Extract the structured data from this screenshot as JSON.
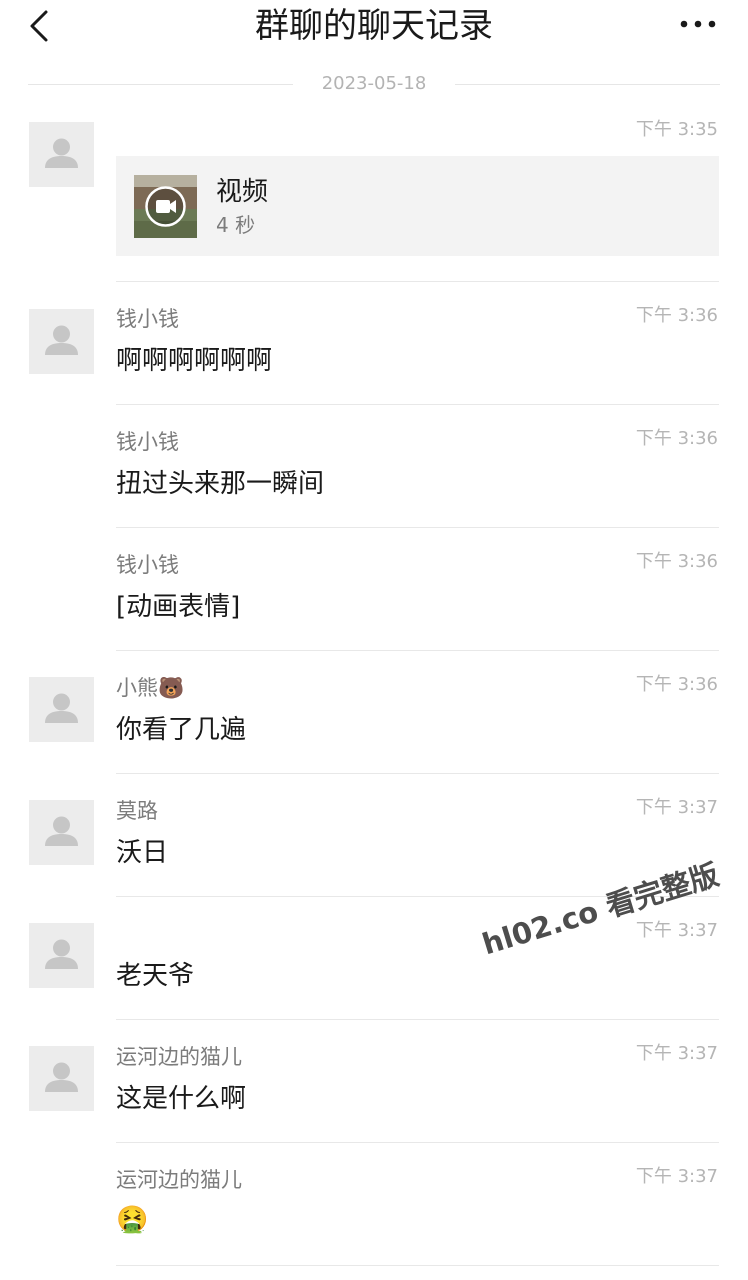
{
  "header": {
    "title": "群聊的聊天记录"
  },
  "date_separator": "2023-05-18",
  "video": {
    "title": "视频",
    "duration": "4 秒"
  },
  "messages": [
    {
      "time": "下午 3:35"
    },
    {
      "sender": "钱小钱",
      "time": "下午 3:36",
      "text": "啊啊啊啊啊啊"
    },
    {
      "sender": "钱小钱",
      "time": "下午 3:36",
      "text": "扭过头来那一瞬间"
    },
    {
      "sender": "钱小钱",
      "time": "下午 3:36",
      "text": "[动画表情]"
    },
    {
      "sender": "小熊🐻",
      "time": "下午 3:36",
      "text": "你看了几遍"
    },
    {
      "sender": "莫路",
      "time": "下午 3:37",
      "text": "沃日"
    },
    {
      "sender": "",
      "time": "下午 3:37",
      "text": "老天爷"
    },
    {
      "sender": "运河边的猫儿",
      "time": "下午 3:37",
      "text": "这是什么啊"
    },
    {
      "sender": "运河边的猫儿",
      "time": "下午 3:37",
      "text": "🤮"
    }
  ],
  "watermark": "hl02.co 看完整版",
  "icons": {
    "back": "chevron-left-icon",
    "more": "more-dots-icon",
    "avatar": "default-avatar-icon",
    "video": "video-camera-icon"
  },
  "colors": {
    "meta_gray": "#b5b5b5",
    "sender_gray": "#7c7c7c",
    "card_bg": "#f3f3f3",
    "avatar_bg": "#ececec"
  }
}
